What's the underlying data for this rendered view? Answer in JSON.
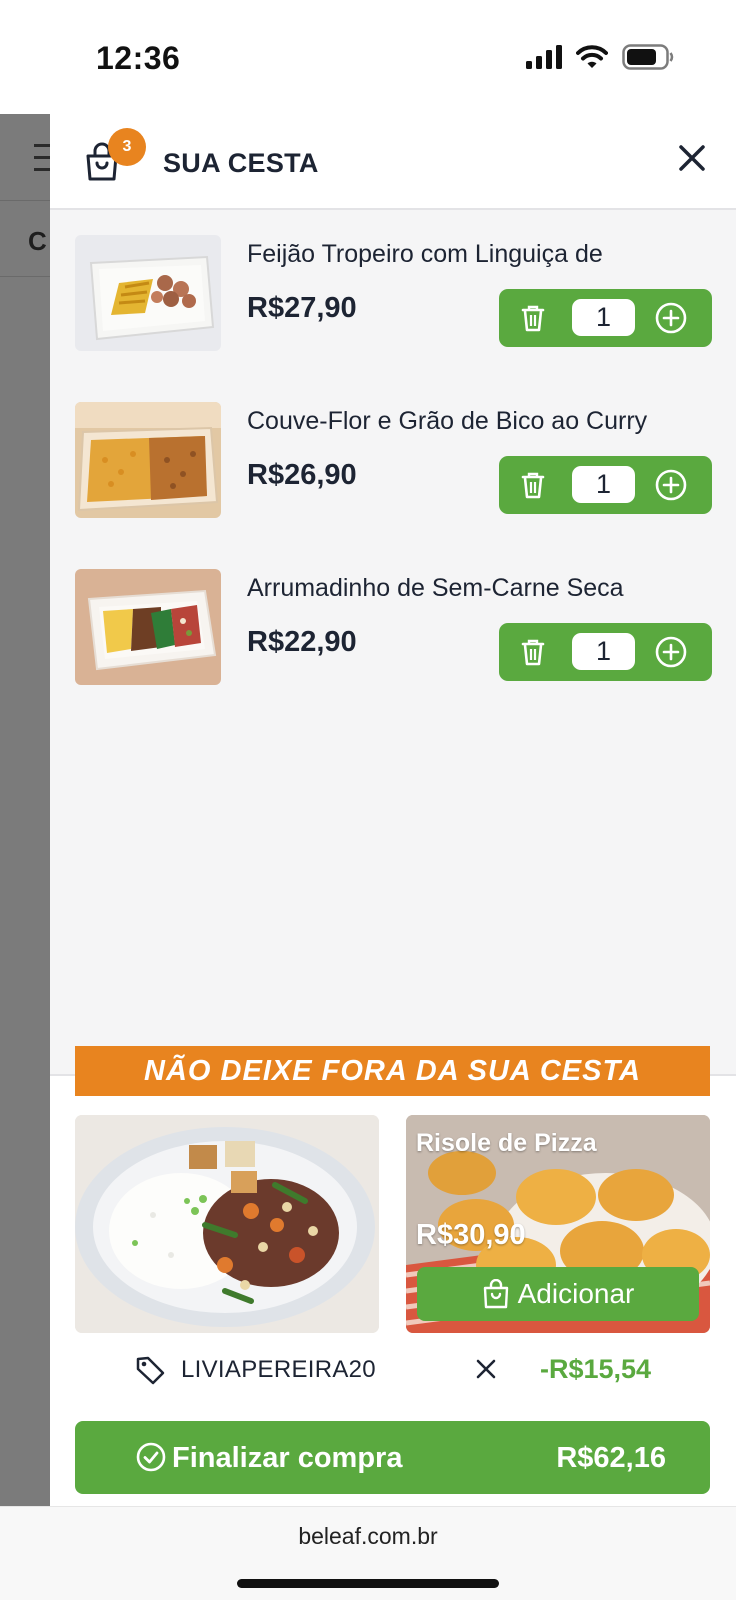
{
  "status_bar": {
    "time": "12:36"
  },
  "underlay": {
    "letter": "C"
  },
  "cart": {
    "badge_count": "3",
    "title": "SUA CESTA",
    "items": [
      {
        "name": "Feijão Tropeiro com Linguiça de",
        "price": "R$27,90",
        "quantity": "1"
      },
      {
        "name": "Couve-Flor e Grão de Bico ao Curry",
        "price": "R$26,90",
        "quantity": "1"
      },
      {
        "name": "Arrumadinho de Sem-Carne Seca",
        "price": "R$22,90",
        "quantity": "1"
      }
    ]
  },
  "upsell": {
    "banner": "NÃO DEIXE FORA DA SUA CESTA",
    "card2": {
      "title": "Risole de Pizza",
      "price": "R$30,90",
      "add_label": "Adicionar"
    }
  },
  "coupon": {
    "code": "LIVIAPEREIRA20",
    "discount": "-R$15,54"
  },
  "checkout": {
    "label": "Finalizar compra",
    "total": "R$62,16"
  },
  "browser": {
    "url": "beleaf.com.br"
  },
  "colors": {
    "green": "#5aa93f",
    "orange": "#e8841f",
    "text": "#1d2433"
  }
}
